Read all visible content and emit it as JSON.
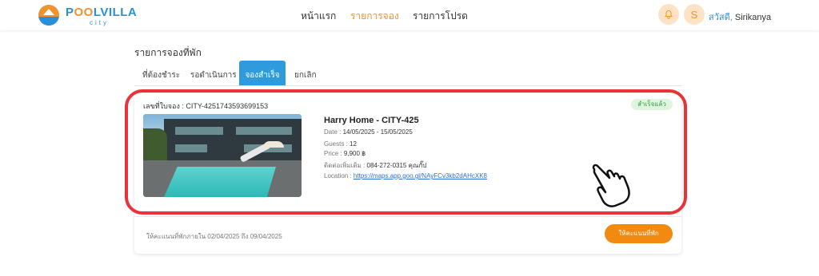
{
  "header": {
    "brand": {
      "pool": "P",
      "oo": "OO",
      "lvilla": "LVILLA",
      "sub": "city"
    },
    "nav": [
      "หน้าแรก",
      "รายการจอง",
      "รายการโปรด"
    ],
    "active_nav": "รายการจอง",
    "avatar_initial": "S",
    "greeting_hi": "สวัสดี,",
    "greeting_name": " Sirikanya",
    "accent": "#f0922f",
    "brand_blue": "#2a8fd6"
  },
  "page": {
    "title": "รายการจองที่พัก",
    "tabs": [
      "ที่ต้องชำระ",
      "รอดำเนินการ",
      "จองสำเร็จ",
      "ยกเลิก"
    ],
    "active_tab": "จองสำเร็จ"
  },
  "booking": {
    "number_label": "เลขที่ใบจอง : ",
    "number_value": "CITY-4251743593699153",
    "status": "สำเร็จแล้ว",
    "status_color": "#2e9a3e",
    "property_name": "Harry Home - CITY-425",
    "date_label": "Date : ",
    "date_value": "14/05/2025 - 15/05/2025",
    "guests_label": "Guests : ",
    "guests_value": "12",
    "price_label": "Price : ",
    "price_value": "9,900 ฿",
    "contact_label": "ติดต่อเพิ่มเติม : ",
    "contact_value": "084-272-0315 คุณกั๊ป",
    "location_label": "Location : ",
    "location_link": "https://maps.app.goo.gl/NAyFCv3kb2dAHcXK8"
  },
  "rating": {
    "window_label": "ให้คะแนนที่พักภายใน  02/04/2025 ถึง 09/04/2025",
    "button_label": "ให้คะแนนที่พัก",
    "button_color": "#f28a12"
  },
  "annotation": {
    "highlight_color": "#e8333b",
    "pointer_icon": "hand-pointer-icon"
  }
}
